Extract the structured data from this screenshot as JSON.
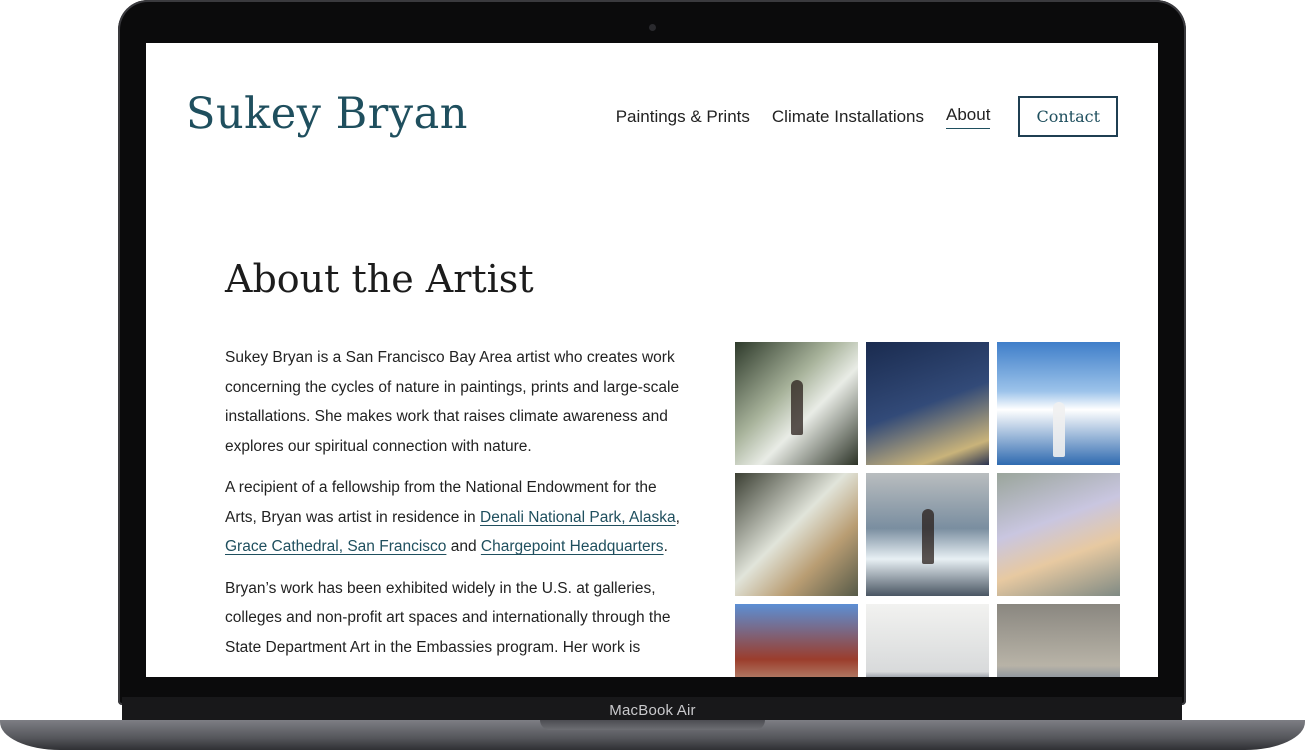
{
  "device": {
    "label": "MacBook Air"
  },
  "site": {
    "title": "Sukey Bryan",
    "nav": {
      "items": [
        {
          "label": "Paintings & Prints"
        },
        {
          "label": "Climate Installations"
        },
        {
          "label": "About",
          "active": true
        }
      ],
      "contact_label": "Contact"
    },
    "accent_color": "#1f4f5e"
  },
  "page": {
    "heading": "About the Artist",
    "paragraph1": "Sukey Bryan is a San Francisco Bay Area artist who creates work concerning the cycles of nature in paintings, prints and large-scale installations. She makes work that raises climate awareness and explores our spiritual connection with nature.",
    "paragraph2": {
      "part1": "A recipient of a fellowship from the National Endowment for the Arts, Bryan was artist in residence in ",
      "link1": "Denali National Park, Alaska",
      "sep1": ", ",
      "link2": "Grace Cathedral, San Francisco",
      "sep2": " and ",
      "link3": "Chargepoint Headquarters",
      "end": "."
    },
    "paragraph3": "Bryan’s work has been exhibited widely in the U.S. at galleries, colleges and non-profit art spaces and internationally through the State Department Art in the Embassies program. Her work is"
  },
  "gallery": {
    "icons": [
      "artist-photo-1",
      "artist-photo-2",
      "artist-photo-3",
      "artist-photo-4",
      "artist-photo-5",
      "artist-photo-6",
      "artist-photo-7",
      "artist-photo-8",
      "artist-photo-9"
    ]
  }
}
